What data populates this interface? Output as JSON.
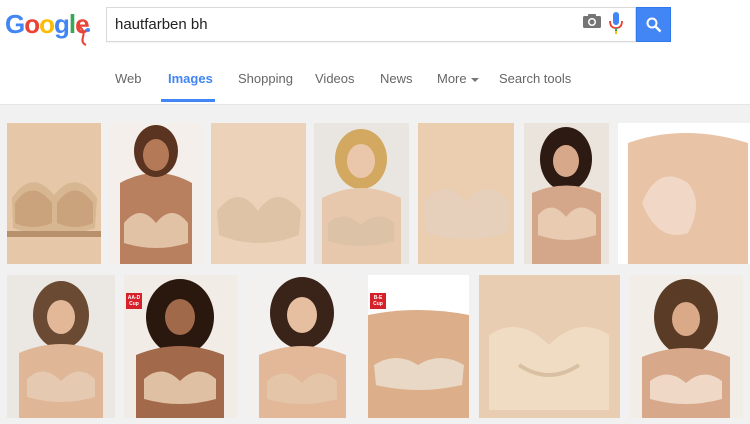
{
  "search": {
    "query": "hautfarben bh"
  },
  "logo": {
    "letters": [
      "G",
      "o",
      "o",
      "g",
      "l",
      "e"
    ],
    "colors": [
      "#4285f4",
      "#ea4335",
      "#fbbc05",
      "#4285f4",
      "#34a853",
      "#ea4335"
    ]
  },
  "tabs": [
    {
      "label": "Web"
    },
    {
      "label": "Images"
    },
    {
      "label": "Shopping"
    },
    {
      "label": "Videos"
    },
    {
      "label": "News"
    },
    {
      "label": "More"
    },
    {
      "label": "Search tools"
    }
  ],
  "badges": {
    "row2_second": "AA-D Cup",
    "row2_fourth": "B-E Cup"
  },
  "colors": {
    "accent": "#4285f4",
    "skin_bg": "#ffffff",
    "bra_nude": "#e2c4a6"
  }
}
